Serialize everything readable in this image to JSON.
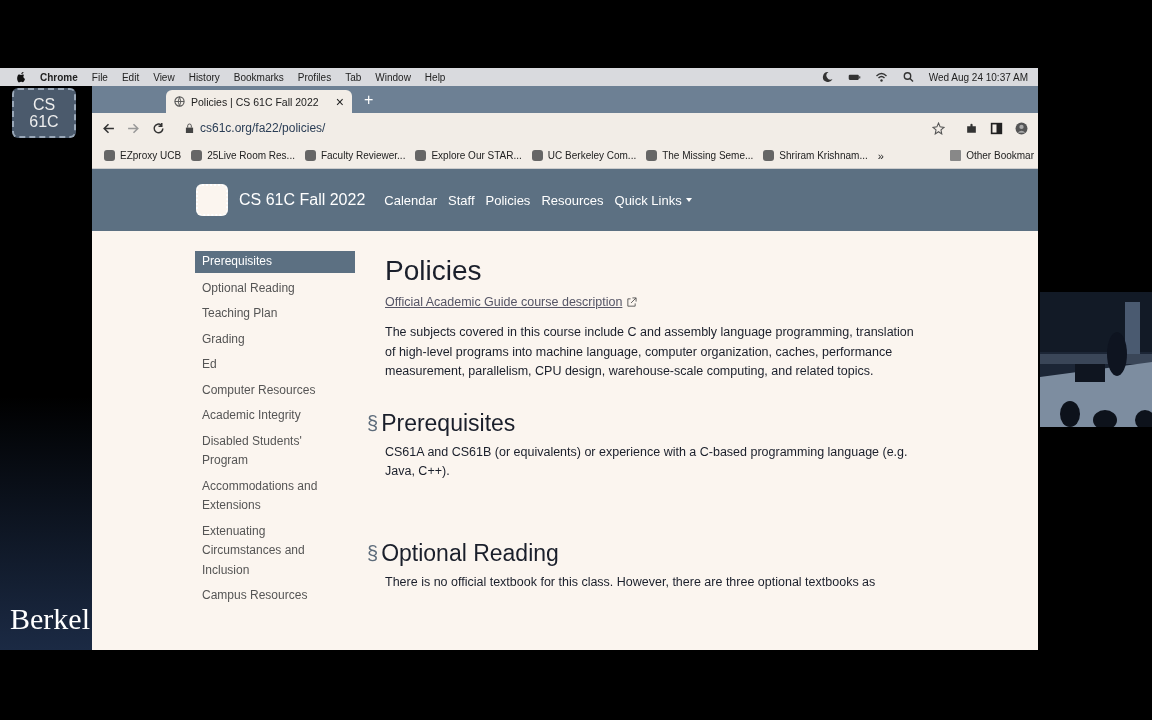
{
  "menu_bar": {
    "app": "Chrome",
    "items": [
      "File",
      "Edit",
      "View",
      "History",
      "Bookmarks",
      "Profiles",
      "Tab",
      "Window",
      "Help"
    ],
    "clock": "Wed Aug 24  10:37 AM"
  },
  "slide": {
    "logo": [
      "CS",
      "61C"
    ],
    "footer": "Berkel"
  },
  "browser": {
    "tab": {
      "title": "Policies | CS 61C Fall 2022",
      "close": "×",
      "new_tab": "+"
    },
    "address": "cs61c.org/fa22/policies/",
    "bookmarks": [
      "EZproxy UCB",
      "25Live Room Res...",
      "Faculty Reviewer...",
      "Explore Our STAR...",
      "UC Berkeley Com...",
      "The Missing Seme...",
      "Shriram Krishnam..."
    ],
    "more_bookmarks": "»",
    "other_bookmarks": "Other Bookmar"
  },
  "site": {
    "brand": "CS 61C Fall 2022",
    "nav": [
      {
        "label": "Calendar",
        "dropdown": false
      },
      {
        "label": "Staff",
        "dropdown": false
      },
      {
        "label": "Policies",
        "dropdown": false
      },
      {
        "label": "Resources",
        "dropdown": false
      },
      {
        "label": "Quick Links",
        "dropdown": true
      }
    ],
    "sidebar": [
      {
        "label": "Prerequisites",
        "selected": true
      },
      {
        "label": "Optional Reading",
        "selected": false
      },
      {
        "label": "Teaching Plan",
        "selected": false
      },
      {
        "label": "Grading",
        "selected": false
      },
      {
        "label": "Ed",
        "selected": false
      },
      {
        "label": "Computer Resources",
        "selected": false
      },
      {
        "label": "Academic Integrity",
        "selected": false
      },
      {
        "label": "Disabled Students' Program",
        "selected": false
      },
      {
        "label": "Accommodations and Extensions",
        "selected": false
      },
      {
        "label": "Extenuating Circumstances and Inclusion",
        "selected": false
      },
      {
        "label": "Campus Resources",
        "selected": false
      }
    ],
    "title": "Policies",
    "link": "Official Academic Guide course description",
    "intro": "The subjects covered in this course include C and assembly language programming, translation of high-level programs into machine language, computer organization, caches, performance measurement, parallelism, CPU design, warehouse-scale computing, and related topics.",
    "sections": [
      {
        "anchor": "§",
        "heading": "Prerequisites",
        "text": "CS61A and CS61B (or equivalents) or experience with a C-based programming language (e.g. Java, C++)."
      },
      {
        "anchor": "§",
        "heading": "Optional Reading",
        "text": "There is no official textbook for this class. However, there are three optional textbooks as"
      }
    ]
  }
}
